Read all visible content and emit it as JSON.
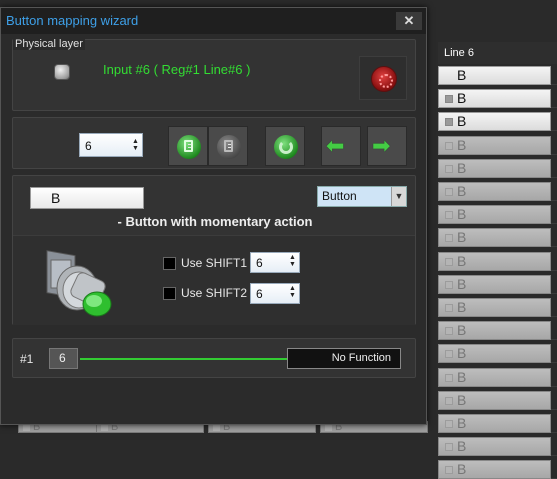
{
  "background": {
    "column_header": "Line 6",
    "rows": [
      {
        "label": "B",
        "enabled": true,
        "marker": false
      },
      {
        "label": "B",
        "enabled": true,
        "marker": true
      },
      {
        "label": "B",
        "enabled": true,
        "marker": true
      },
      {
        "label": "B",
        "enabled": false,
        "marker": true
      },
      {
        "label": "B",
        "enabled": false,
        "marker": true
      },
      {
        "label": "B",
        "enabled": false,
        "marker": true
      },
      {
        "label": "B",
        "enabled": false,
        "marker": true
      },
      {
        "label": "B",
        "enabled": false,
        "marker": true
      },
      {
        "label": "B",
        "enabled": false,
        "marker": true
      },
      {
        "label": "B",
        "enabled": false,
        "marker": true
      },
      {
        "label": "B",
        "enabled": false,
        "marker": true
      },
      {
        "label": "B",
        "enabled": false,
        "marker": true
      },
      {
        "label": "B",
        "enabled": false,
        "marker": true
      },
      {
        "label": "B",
        "enabled": false,
        "marker": true
      },
      {
        "label": "B",
        "enabled": false,
        "marker": true
      },
      {
        "label": "B",
        "enabled": false,
        "marker": true
      },
      {
        "label": "B",
        "enabled": false,
        "marker": true
      },
      {
        "label": "B",
        "enabled": false,
        "marker": true
      }
    ],
    "bottom_cells": [
      "B",
      "B",
      "B",
      "B"
    ]
  },
  "dialog": {
    "title": "Button mapping wizard",
    "close_glyph": "✕",
    "physical": {
      "legend": "Physical layer",
      "input_text": "Input #6  ( Reg#1  Line#6 )"
    },
    "toolbar": {
      "line_value": "6",
      "spin_arrows": "▲▼",
      "prev_glyph": "⬅",
      "next_glyph": "➡"
    },
    "button": {
      "name": "B",
      "type": "Button",
      "type_arrow": "▼",
      "description": "- Button with momentary action",
      "shift1": {
        "label": "Use SHIFT1",
        "value": "6",
        "checked": false
      },
      "shift2": {
        "label": "Use SHIFT2",
        "value": "6",
        "checked": false
      }
    },
    "function": {
      "index": "#1",
      "value": "6",
      "name": "No Function"
    }
  },
  "colors": {
    "title": "#3ea0e8",
    "status_green": "#33dd33",
    "function_line": "#33cc33"
  }
}
